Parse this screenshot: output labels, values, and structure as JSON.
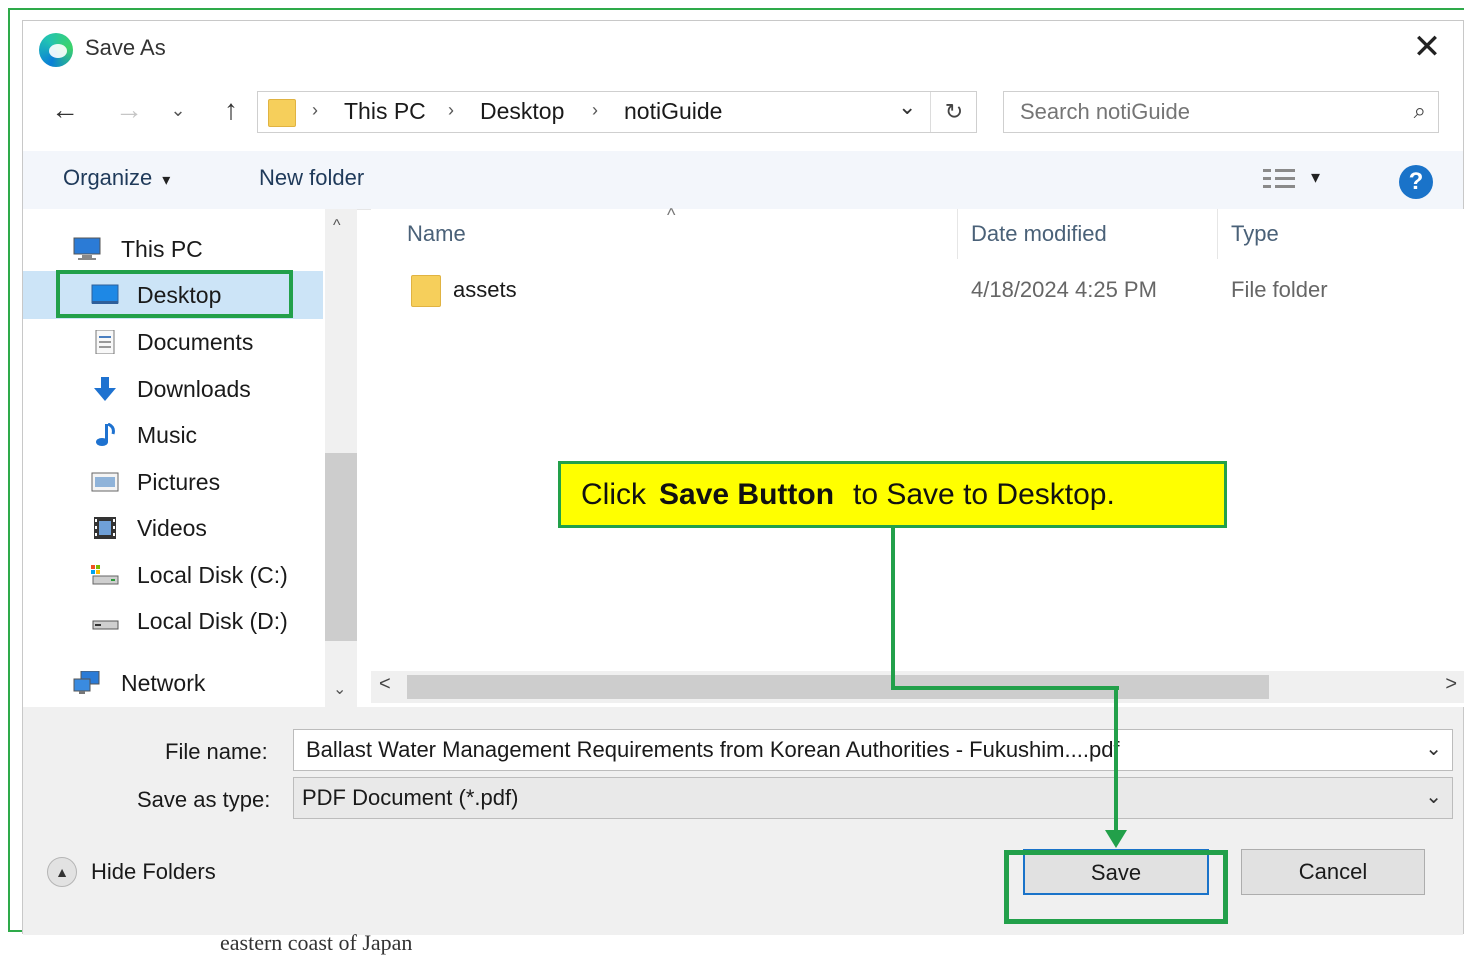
{
  "dialog": {
    "title": "Save As",
    "close_glyph": "✕",
    "app_icon": "edge-browser-icon"
  },
  "nav": {
    "back_glyph": "←",
    "forward_glyph": "→",
    "recent_glyph": "⌄",
    "up_glyph": "↑",
    "breadcrumb": [
      "This PC",
      "Desktop",
      "notiGuide"
    ],
    "separator": "›",
    "refresh_glyph": "↻",
    "dropdown_glyph": "⌄"
  },
  "search": {
    "placeholder": "Search notiGuide",
    "icon_glyph": "⌕"
  },
  "toolbar": {
    "organize_label": "Organize",
    "organize_caret": "▾",
    "new_folder_label": "New folder",
    "view_caret": "▾",
    "help_glyph": "?"
  },
  "sidebar": {
    "items": [
      {
        "label": "This PC",
        "icon": "computer-icon"
      },
      {
        "label": "Desktop",
        "icon": "desktop-icon",
        "selected": true
      },
      {
        "label": "Documents",
        "icon": "documents-icon"
      },
      {
        "label": "Downloads",
        "icon": "downloads-icon"
      },
      {
        "label": "Music",
        "icon": "music-icon"
      },
      {
        "label": "Pictures",
        "icon": "pictures-icon"
      },
      {
        "label": "Videos",
        "icon": "videos-icon"
      },
      {
        "label": "Local Disk (C:)",
        "icon": "drive-c-icon"
      },
      {
        "label": "Local Disk (D:)",
        "icon": "drive-d-icon"
      },
      {
        "label": "Network",
        "icon": "network-icon"
      }
    ],
    "scroll_up_glyph": "^",
    "scroll_down_glyph": "⌄"
  },
  "files": {
    "sort_glyph": "^",
    "columns": [
      "Name",
      "Date modified",
      "Type"
    ],
    "rows": [
      {
        "name": "assets",
        "date": "4/18/2024 4:25 PM",
        "type": "File folder",
        "icon": "folder-icon"
      }
    ],
    "scroll_left_glyph": "<",
    "scroll_right_glyph": ">"
  },
  "form": {
    "file_name_label": "File name:",
    "file_name_value": "Ballast Water Management Requirements from Korean Authorities - Fukushim....pdf",
    "save_type_label": "Save as type:",
    "save_type_value": "PDF Document (*.pdf)",
    "dropdown_glyph": "⌄"
  },
  "footer": {
    "hide_folders_label": "Hide Folders",
    "hide_folders_glyph": "▲",
    "save_label": "Save",
    "cancel_label": "Cancel"
  },
  "annotation": {
    "callout_prefix": "Click ",
    "callout_bold": "Save Button",
    "callout_suffix": " to Save to Desktop.",
    "highlight_color": "#22a04a",
    "callout_bg": "#ffff00"
  },
  "background": {
    "partial_text": "eastern coast of Japan"
  }
}
